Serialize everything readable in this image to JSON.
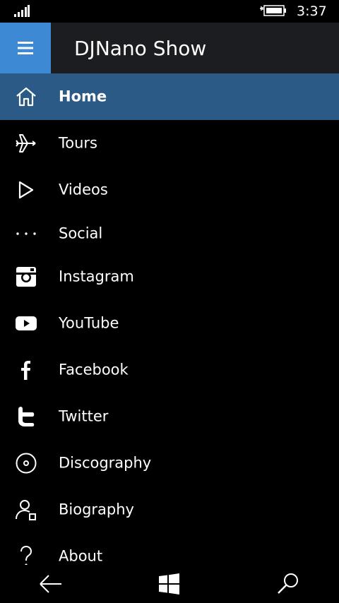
{
  "status_bar": {
    "time": "3:37",
    "signal_icon": "signal-bars-icon",
    "battery_icon": "battery-charging-icon"
  },
  "header": {
    "title": "DJNano Show",
    "menu_icon": "hamburger-icon",
    "accent": "#3d89d4",
    "background": "#1c1d20"
  },
  "menu": {
    "selected_color": "#2b5a86",
    "items": [
      {
        "label": "Home",
        "icon": "home-icon",
        "selected": true
      },
      {
        "label": "Tours",
        "icon": "airplane-icon"
      },
      {
        "label": "Videos",
        "icon": "play-icon"
      },
      {
        "label": "Social",
        "icon": "more-dots-icon"
      },
      {
        "label": "Instagram",
        "icon": "instagram-icon"
      },
      {
        "label": "YouTube",
        "icon": "youtube-icon"
      },
      {
        "label": "Facebook",
        "icon": "facebook-icon"
      },
      {
        "label": "Twitter",
        "icon": "twitter-icon"
      },
      {
        "label": "Discography",
        "icon": "disc-icon"
      },
      {
        "label": "Biography",
        "icon": "person-icon"
      },
      {
        "label": "About",
        "icon": "question-icon"
      }
    ]
  },
  "nav_bar": {
    "back_icon": "back-arrow-icon",
    "start_icon": "windows-start-icon",
    "search_icon": "search-icon"
  }
}
